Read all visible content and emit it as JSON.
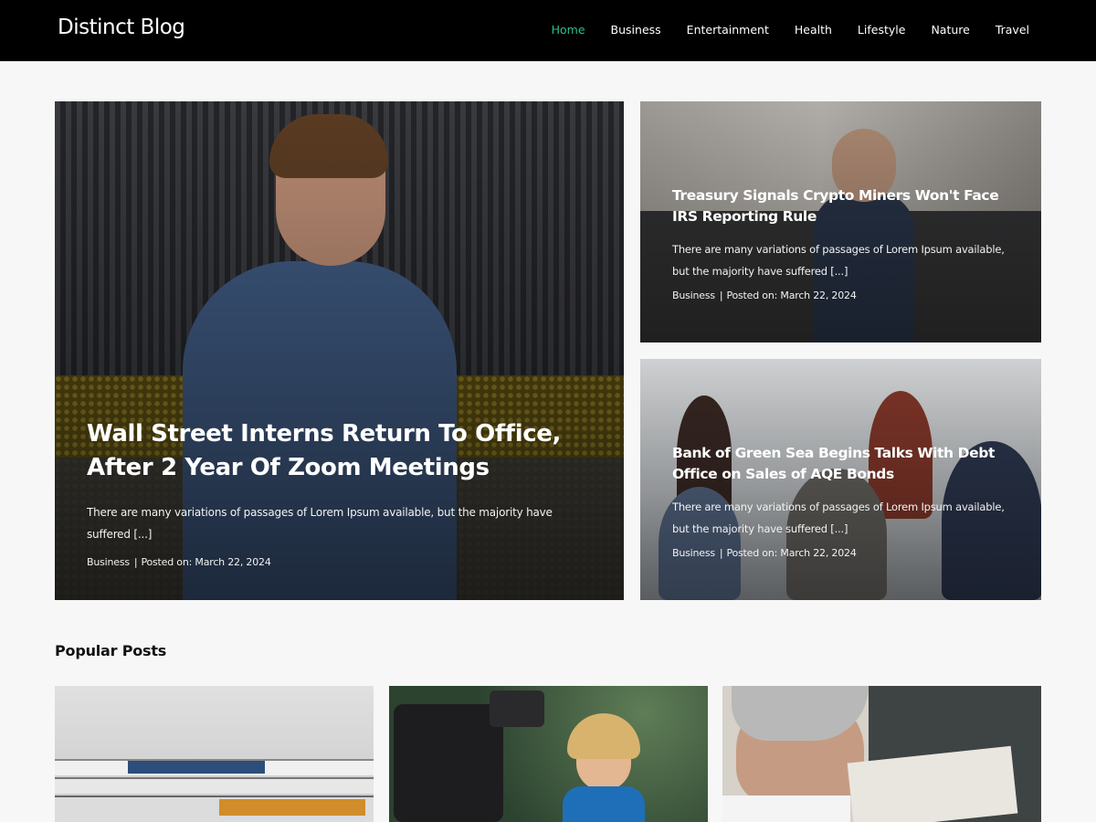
{
  "header": {
    "site_title": "Distinct Blog",
    "nav": [
      "Home",
      "Business",
      "Entertainment",
      "Health",
      "Lifestyle",
      "Nature",
      "Travel"
    ],
    "active_nav": "Home",
    "accent_color": "#27c08d"
  },
  "featured": [
    {
      "title": "Wall Street Interns Return To Office, After 2 Year Of Zoom Meetings",
      "excerpt": "There are many variations of passages of Lorem Ipsum available, but the majority have suffered [...]",
      "category": "Business",
      "separator": "|",
      "posted": "Posted on: March 22, 2024"
    },
    {
      "title": "Treasury Signals Crypto Miners Won't Face IRS Reporting Rule",
      "excerpt": "There are many variations of passages of Lorem Ipsum available, but the majority have suffered [...]",
      "category": "Business",
      "separator": "|",
      "posted": "Posted on: March 22, 2024"
    },
    {
      "title": "Bank of Green Sea Begins Talks With Debt Office on Sales of AQE Bonds",
      "excerpt": "There are many variations of passages of Lorem Ipsum available, but the majority have suffered [...]",
      "category": "Business",
      "separator": "|",
      "posted": "Posted on: March 22, 2024"
    }
  ],
  "popular": {
    "section_title": "Popular Posts"
  }
}
